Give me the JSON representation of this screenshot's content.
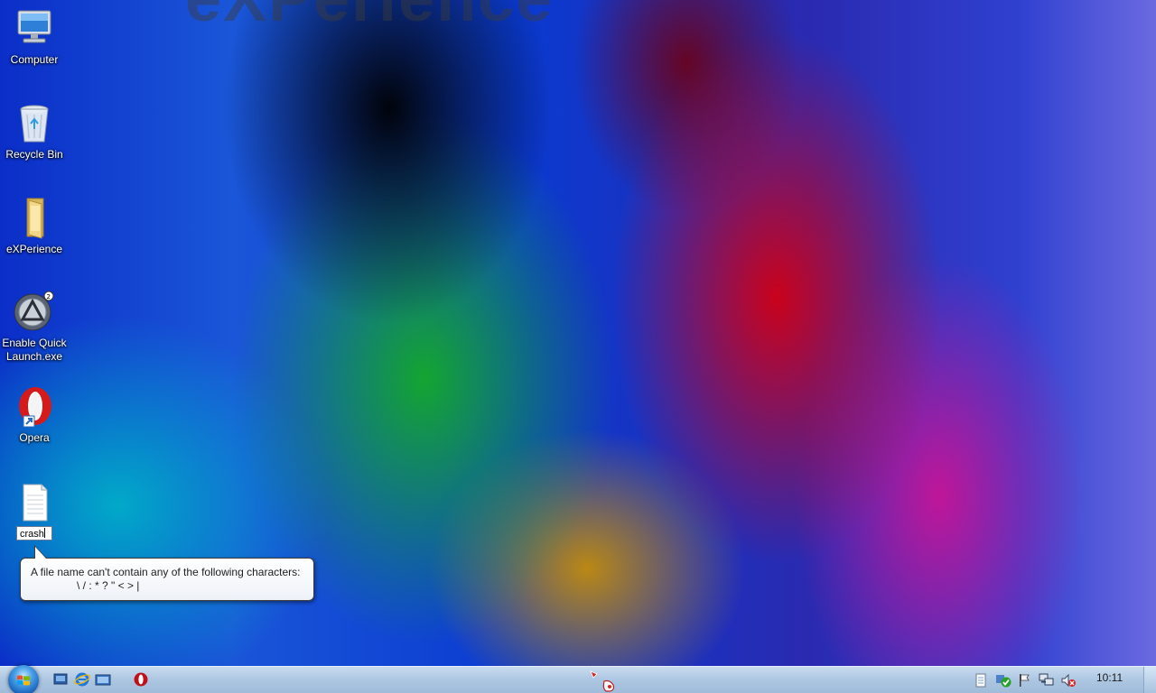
{
  "desktop": {
    "watermark": "eXPerience",
    "icons": [
      {
        "label": "Computer",
        "icon": "computer-icon"
      },
      {
        "label": "Recycle Bin",
        "icon": "recycle-bin-icon"
      },
      {
        "label": "eXPerience",
        "icon": "folder-icon"
      },
      {
        "label": "Enable Quick Launch.exe",
        "icon": "quick-launch-app-icon"
      },
      {
        "label": "Opera",
        "icon": "opera-icon"
      }
    ],
    "rename": {
      "icon": "text-file-icon",
      "value": "crash"
    },
    "balloon": {
      "line1": "A file name can't contain any of the following characters:",
      "line2": "\\ / : * ? \" < > |"
    }
  },
  "taskbar": {
    "start_icon": "windows-start-orb-icon",
    "quick_launch": [
      "show-desktop-icon",
      "internet-explorer-icon",
      "switch-windows-icon"
    ],
    "pinned": [
      "opera-taskbar-icon"
    ],
    "tray": [
      "notepad-tray-icon",
      "security-center-icon",
      "action-center-flag-icon",
      "network-icon",
      "volume-muted-icon"
    ],
    "clock": "10:11"
  }
}
